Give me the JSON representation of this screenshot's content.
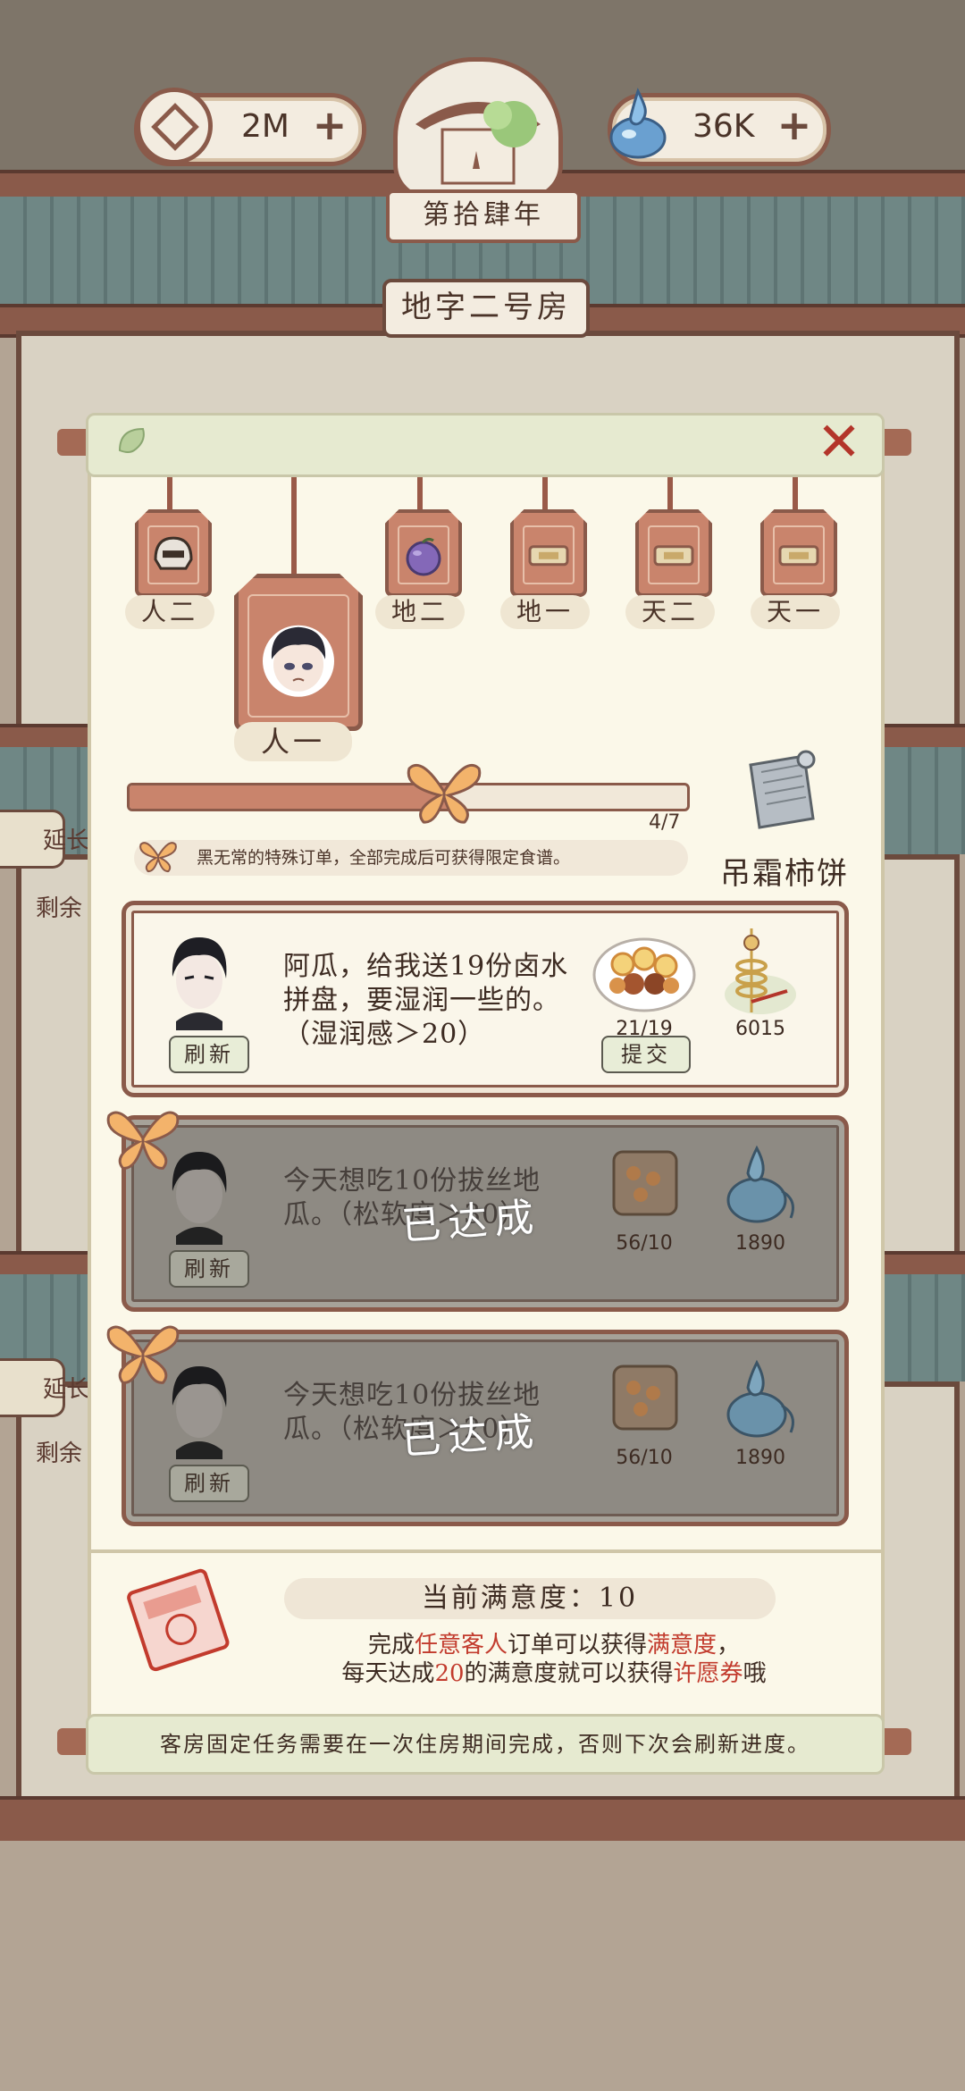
{
  "hud": {
    "coins": "2M",
    "water": "36K",
    "year": "第拾肆年",
    "room_name": "地字二号房"
  },
  "side": {
    "extend_label_1": "延长",
    "remain_label_1": "剩余",
    "extend_label_2": "延长",
    "remain_label_2": "剩余"
  },
  "tabs": [
    {
      "label": "人二",
      "icon": "helmet-icon"
    },
    {
      "label": "人一",
      "icon": "character-portrait-icon",
      "selected": true
    },
    {
      "label": "地二",
      "icon": "purple-fruit-icon"
    },
    {
      "label": "地一",
      "icon": "locked-icon"
    },
    {
      "label": "天二",
      "icon": "locked-icon"
    },
    {
      "label": "天一",
      "icon": "locked-icon"
    }
  ],
  "progress": {
    "text": "4/7",
    "fraction": 0.571,
    "hint": "黑无常的特殊订单，全部完成后可获得限定食谱。",
    "reward_name": "吊霜柿饼"
  },
  "orders": [
    {
      "text": "阿瓜，给我送19份卤水拼盘，要湿润一些的。（湿润感＞20）",
      "dish_count": "21/19",
      "reward_count": "6015",
      "refresh_label": "刷新",
      "submit_label": "提交",
      "reward_icon": "coin-string-icon"
    },
    {
      "text": "今天想吃10份拔丝地瓜。（松软度＞30）",
      "dish_count": "56/10",
      "reward_count": "1890",
      "refresh_label": "刷新",
      "done_label": "已达成",
      "reward_icon": "water-drop-icon"
    },
    {
      "text": "今天想吃10份拔丝地瓜。（松软度＞20）",
      "dish_count": "56/10",
      "reward_count": "1890",
      "refresh_label": "刷新",
      "done_label": "已达成",
      "reward_icon": "water-drop-icon"
    }
  ],
  "satisfaction": {
    "title": "当前满意度：10",
    "line1_a": "完成",
    "line1_b": "任意客人",
    "line1_c": "订单可以获得",
    "line1_d": "满意度",
    "line1_e": "，",
    "line2_a": "每天达成",
    "line2_b": "20",
    "line2_c": "的满意度就可以获得",
    "line2_d": "许愿券",
    "line2_e": "哦"
  },
  "footer_note": "客房固定任务需要在一次住房期间完成，否则下次会刷新进度。",
  "colors": {
    "accent": "#8a5a4a",
    "tag": "#c9846c",
    "highlight_red": "#c23b2d",
    "panel_bg": "#fbf8e9"
  }
}
